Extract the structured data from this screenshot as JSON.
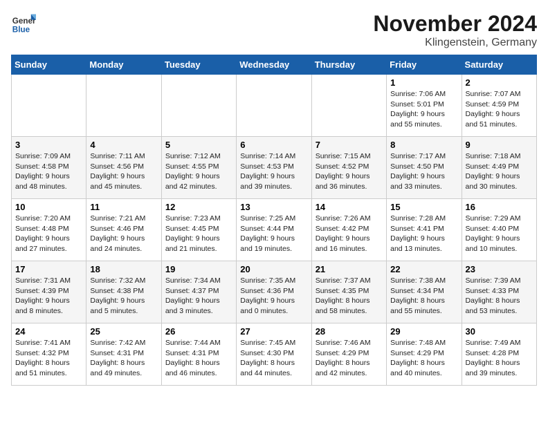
{
  "logo": {
    "line1": "General",
    "line2": "Blue"
  },
  "title": "November 2024",
  "location": "Klingenstein, Germany",
  "days_of_week": [
    "Sunday",
    "Monday",
    "Tuesday",
    "Wednesday",
    "Thursday",
    "Friday",
    "Saturday"
  ],
  "weeks": [
    [
      null,
      null,
      null,
      null,
      null,
      {
        "day": "1",
        "sunrise": "Sunrise: 7:06 AM",
        "sunset": "Sunset: 5:01 PM",
        "daylight": "Daylight: 9 hours and 55 minutes."
      },
      {
        "day": "2",
        "sunrise": "Sunrise: 7:07 AM",
        "sunset": "Sunset: 4:59 PM",
        "daylight": "Daylight: 9 hours and 51 minutes."
      }
    ],
    [
      {
        "day": "3",
        "sunrise": "Sunrise: 7:09 AM",
        "sunset": "Sunset: 4:58 PM",
        "daylight": "Daylight: 9 hours and 48 minutes."
      },
      {
        "day": "4",
        "sunrise": "Sunrise: 7:11 AM",
        "sunset": "Sunset: 4:56 PM",
        "daylight": "Daylight: 9 hours and 45 minutes."
      },
      {
        "day": "5",
        "sunrise": "Sunrise: 7:12 AM",
        "sunset": "Sunset: 4:55 PM",
        "daylight": "Daylight: 9 hours and 42 minutes."
      },
      {
        "day": "6",
        "sunrise": "Sunrise: 7:14 AM",
        "sunset": "Sunset: 4:53 PM",
        "daylight": "Daylight: 9 hours and 39 minutes."
      },
      {
        "day": "7",
        "sunrise": "Sunrise: 7:15 AM",
        "sunset": "Sunset: 4:52 PM",
        "daylight": "Daylight: 9 hours and 36 minutes."
      },
      {
        "day": "8",
        "sunrise": "Sunrise: 7:17 AM",
        "sunset": "Sunset: 4:50 PM",
        "daylight": "Daylight: 9 hours and 33 minutes."
      },
      {
        "day": "9",
        "sunrise": "Sunrise: 7:18 AM",
        "sunset": "Sunset: 4:49 PM",
        "daylight": "Daylight: 9 hours and 30 minutes."
      }
    ],
    [
      {
        "day": "10",
        "sunrise": "Sunrise: 7:20 AM",
        "sunset": "Sunset: 4:48 PM",
        "daylight": "Daylight: 9 hours and 27 minutes."
      },
      {
        "day": "11",
        "sunrise": "Sunrise: 7:21 AM",
        "sunset": "Sunset: 4:46 PM",
        "daylight": "Daylight: 9 hours and 24 minutes."
      },
      {
        "day": "12",
        "sunrise": "Sunrise: 7:23 AM",
        "sunset": "Sunset: 4:45 PM",
        "daylight": "Daylight: 9 hours and 21 minutes."
      },
      {
        "day": "13",
        "sunrise": "Sunrise: 7:25 AM",
        "sunset": "Sunset: 4:44 PM",
        "daylight": "Daylight: 9 hours and 19 minutes."
      },
      {
        "day": "14",
        "sunrise": "Sunrise: 7:26 AM",
        "sunset": "Sunset: 4:42 PM",
        "daylight": "Daylight: 9 hours and 16 minutes."
      },
      {
        "day": "15",
        "sunrise": "Sunrise: 7:28 AM",
        "sunset": "Sunset: 4:41 PM",
        "daylight": "Daylight: 9 hours and 13 minutes."
      },
      {
        "day": "16",
        "sunrise": "Sunrise: 7:29 AM",
        "sunset": "Sunset: 4:40 PM",
        "daylight": "Daylight: 9 hours and 10 minutes."
      }
    ],
    [
      {
        "day": "17",
        "sunrise": "Sunrise: 7:31 AM",
        "sunset": "Sunset: 4:39 PM",
        "daylight": "Daylight: 9 hours and 8 minutes."
      },
      {
        "day": "18",
        "sunrise": "Sunrise: 7:32 AM",
        "sunset": "Sunset: 4:38 PM",
        "daylight": "Daylight: 9 hours and 5 minutes."
      },
      {
        "day": "19",
        "sunrise": "Sunrise: 7:34 AM",
        "sunset": "Sunset: 4:37 PM",
        "daylight": "Daylight: 9 hours and 3 minutes."
      },
      {
        "day": "20",
        "sunrise": "Sunrise: 7:35 AM",
        "sunset": "Sunset: 4:36 PM",
        "daylight": "Daylight: 9 hours and 0 minutes."
      },
      {
        "day": "21",
        "sunrise": "Sunrise: 7:37 AM",
        "sunset": "Sunset: 4:35 PM",
        "daylight": "Daylight: 8 hours and 58 minutes."
      },
      {
        "day": "22",
        "sunrise": "Sunrise: 7:38 AM",
        "sunset": "Sunset: 4:34 PM",
        "daylight": "Daylight: 8 hours and 55 minutes."
      },
      {
        "day": "23",
        "sunrise": "Sunrise: 7:39 AM",
        "sunset": "Sunset: 4:33 PM",
        "daylight": "Daylight: 8 hours and 53 minutes."
      }
    ],
    [
      {
        "day": "24",
        "sunrise": "Sunrise: 7:41 AM",
        "sunset": "Sunset: 4:32 PM",
        "daylight": "Daylight: 8 hours and 51 minutes."
      },
      {
        "day": "25",
        "sunrise": "Sunrise: 7:42 AM",
        "sunset": "Sunset: 4:31 PM",
        "daylight": "Daylight: 8 hours and 49 minutes."
      },
      {
        "day": "26",
        "sunrise": "Sunrise: 7:44 AM",
        "sunset": "Sunset: 4:31 PM",
        "daylight": "Daylight: 8 hours and 46 minutes."
      },
      {
        "day": "27",
        "sunrise": "Sunrise: 7:45 AM",
        "sunset": "Sunset: 4:30 PM",
        "daylight": "Daylight: 8 hours and 44 minutes."
      },
      {
        "day": "28",
        "sunrise": "Sunrise: 7:46 AM",
        "sunset": "Sunset: 4:29 PM",
        "daylight": "Daylight: 8 hours and 42 minutes."
      },
      {
        "day": "29",
        "sunrise": "Sunrise: 7:48 AM",
        "sunset": "Sunset: 4:29 PM",
        "daylight": "Daylight: 8 hours and 40 minutes."
      },
      {
        "day": "30",
        "sunrise": "Sunrise: 7:49 AM",
        "sunset": "Sunset: 4:28 PM",
        "daylight": "Daylight: 8 hours and 39 minutes."
      }
    ]
  ]
}
